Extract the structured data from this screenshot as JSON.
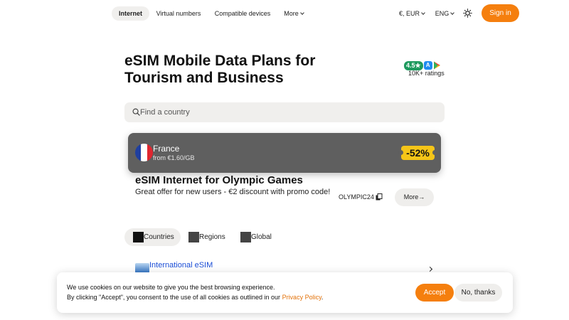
{
  "nav": {
    "tabs": [
      {
        "label": "Internet",
        "active": true
      },
      {
        "label": "Virtual numbers",
        "active": false
      },
      {
        "label": "Compatible devices",
        "active": false
      },
      {
        "label": "More",
        "active": false
      }
    ],
    "currency": "€, EUR",
    "language": "ENG",
    "sign_in": "Sign in",
    "accent_color": "#f57f0e"
  },
  "hero": {
    "title": "eSIM Mobile Data Plans for Tourism and Business",
    "rating": "4.5",
    "ratings_count": "10K+ ratings"
  },
  "search": {
    "placeholder": "Find a country"
  },
  "country_card": {
    "name": "France",
    "price": "from €1.60/GB",
    "discount": "-52%",
    "flag_colors": [
      "#1f3fa0",
      "#ffffff",
      "#e0262f"
    ]
  },
  "promo": {
    "title": "eSIM Internet for Olympic Games",
    "text": "Great offer for new users - €2 discount with promo code!",
    "code": "OLYMPIC24",
    "more": "More"
  },
  "segments": [
    {
      "label": "Countries",
      "active": true
    },
    {
      "label": "Regions",
      "active": false
    },
    {
      "label": "Global",
      "active": false
    }
  ],
  "list": {
    "item_label": "International eSIM"
  },
  "cookie": {
    "line1": "We use cookies on our website to give you the best browsing experience.",
    "line2_prefix": "By clicking \"Accept\", you consent to the use of all cookies as outlined in our ",
    "link": "Privacy Policy",
    "line2_suffix": ".",
    "accept": "Accept",
    "decline": "No, thanks"
  }
}
